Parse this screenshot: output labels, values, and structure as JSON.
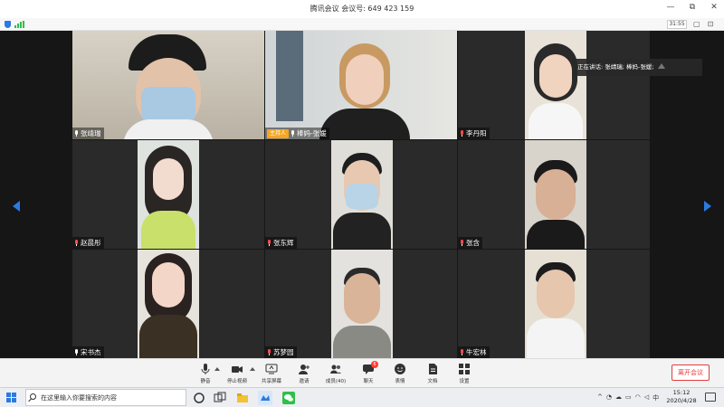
{
  "window": {
    "title": "腾讯会议 会议号: 649 423 159",
    "controls": [
      "—",
      "⧉",
      "✕"
    ]
  },
  "infobar": {
    "time": "31:55",
    "icons": [
      "▢",
      "⊡"
    ]
  },
  "speaking": {
    "text": "正在讲话: 张靖瑞; 棒妈-张媛;"
  },
  "participants": [
    {
      "name": "张靖瑞",
      "host": false,
      "muted": false
    },
    {
      "name": "棒妈-张媛",
      "host": true,
      "host_label": "主持人",
      "muted": false
    },
    {
      "name": "李丹阳",
      "host": false,
      "muted": true
    },
    {
      "name": "赵晨彤",
      "host": false,
      "muted": true
    },
    {
      "name": "张东辉",
      "host": false,
      "muted": true
    },
    {
      "name": "张含",
      "host": false,
      "muted": true
    },
    {
      "name": "宋书杰",
      "host": false,
      "muted": false
    },
    {
      "name": "苏梦园",
      "host": false,
      "muted": true
    },
    {
      "name": "牛宏林",
      "host": false,
      "muted": true
    }
  ],
  "toolbar": {
    "mute": "静音",
    "stop_video": "停止视频",
    "share_screen": "共享屏幕",
    "invite": "邀请",
    "members": "成员(40)",
    "chat": "聊天",
    "chat_badge": "6",
    "emoji": "表情",
    "docs": "文档",
    "settings": "设置",
    "leave": "离开会议"
  },
  "taskbar": {
    "search_placeholder": "在这里输入你要搜索的内容",
    "time": "15:12",
    "date": "2020/4/28"
  },
  "colors": {
    "accent": "#2a7ae2",
    "host_badge": "#f5a623",
    "leave": "#e23b3b"
  }
}
